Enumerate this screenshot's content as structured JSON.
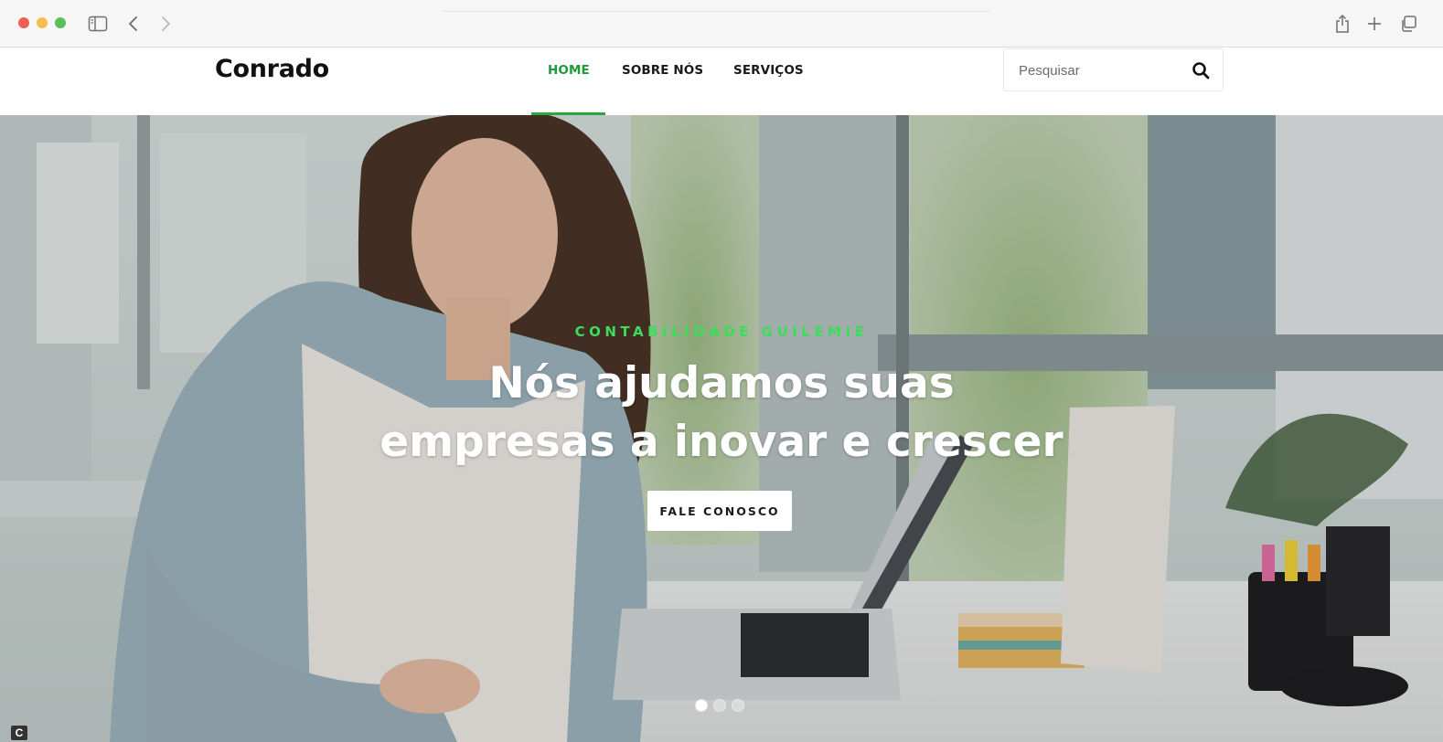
{
  "browser": {
    "icons": [
      "sidebar-icon",
      "back-icon",
      "forward-icon",
      "share-icon",
      "new-tab-icon",
      "tabs-overview-icon"
    ]
  },
  "header": {
    "logo": "Conrado",
    "nav": {
      "home": "HOME",
      "sobre": "SOBRE NÓS",
      "servicos": "SERVIÇOS"
    },
    "active_nav": "HOME",
    "search": {
      "placeholder": "Pesquisar"
    }
  },
  "hero": {
    "eyebrow": "CONTABILIDADE GUILEMIE",
    "headline_line1": "Nós ajudamos suas",
    "headline_line2": "empresas a inovar e crescer",
    "cta_label": "FALE CONOSCO",
    "slides": {
      "count": 3,
      "active": 1
    },
    "corner_badge": "C"
  },
  "colors": {
    "accent": "#2aa83f",
    "eyebrow": "#3cdc5c",
    "text": "#111111"
  }
}
